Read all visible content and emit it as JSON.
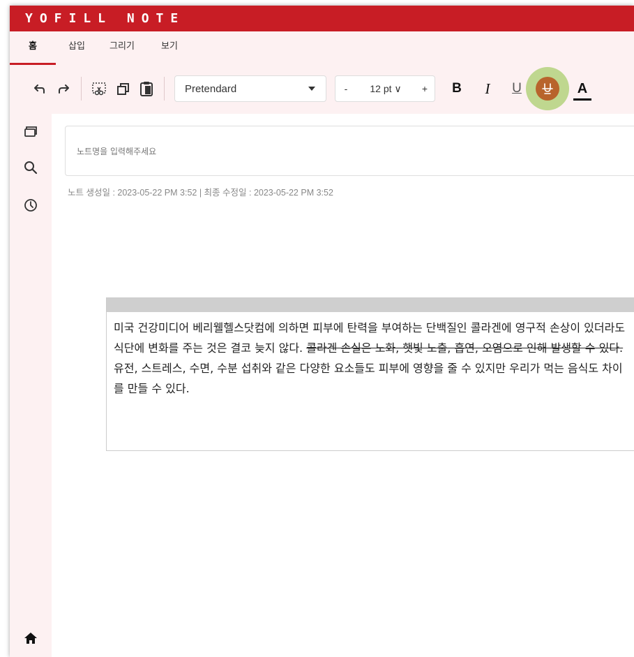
{
  "app": {
    "title": "YOFILL NOTE"
  },
  "tabs": [
    {
      "label": "홈",
      "active": true
    },
    {
      "label": "삽입"
    },
    {
      "label": "그리기"
    },
    {
      "label": "보기"
    }
  ],
  "toolbar": {
    "font_family": "Pretendard",
    "size_minus": "-",
    "font_size": "12 pt ∨",
    "size_plus": "+",
    "bold_label": "B",
    "italic_label": "I",
    "underline_label": "U",
    "fontcolor_label": "A"
  },
  "note": {
    "title_placeholder": "노트명을 입력해주세요",
    "meta": "노트 생성일 : 2023-05-22 PM 3:52  |  최종 수정일 : 2023-05-22 PM 3:52",
    "text_before": "미국 건강미디어 베리웰헬스닷컴에 의하면 피부에 탄력을 부여하는 단백질인 콜라겐에 영구적 손상이 있더라도 식단에 변화를 주는 것은 결코 늦지 않다. ",
    "text_strike": "콜라겐 손실은 노화, 햇빛 노출, 흡연, 오염으로 인해 발생할 수 있다.",
    "text_after": " 유전, 스트레스, 수면, 수분 섭취와 같은 다양한 요소들도 피부에 영향을 줄 수 있지만 우리가 먹는 음식도 차이를 만들 수 있다."
  },
  "colors": {
    "brand": "#c81d25",
    "ribbon_bg": "#fdf1f2",
    "highlight": "#aacd6e",
    "strike_active": "#b8642c"
  }
}
